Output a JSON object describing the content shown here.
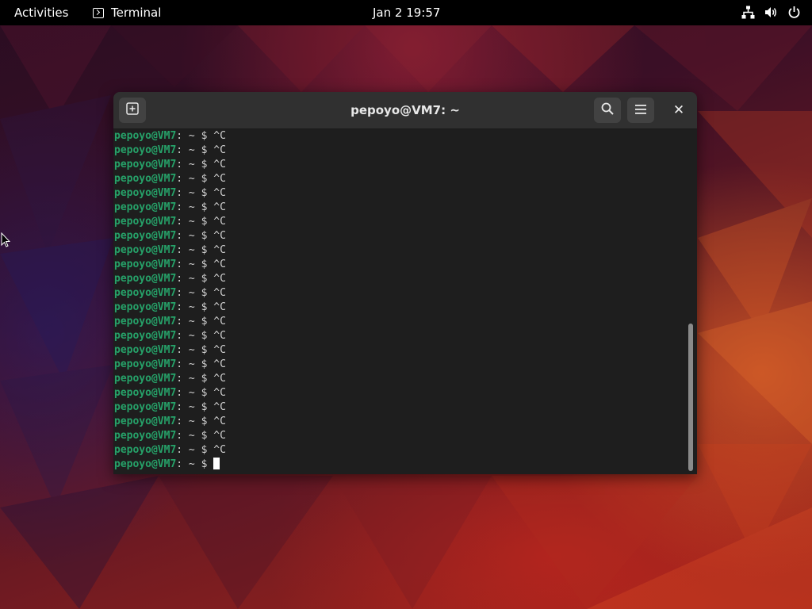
{
  "topbar": {
    "activities_label": "Activities",
    "app_name": "Terminal",
    "clock": "Jan 2  19:57",
    "tray_icons": [
      "network-icon",
      "volume-icon",
      "power-icon"
    ]
  },
  "window": {
    "title": "pepoyo@VM7: ~",
    "buttons": [
      "new-tab-icon",
      "search-icon",
      "hamburger-menu-icon",
      "close-icon"
    ],
    "close_glyph": "✕"
  },
  "terminal": {
    "prompt_user": "pepoyo@VM7",
    "prompt_sep": ":",
    "prompt_path": " ~",
    "prompt_symbol": " $ ",
    "lines": [
      "^C",
      "^C",
      "^C",
      "^C",
      "^C",
      "^C",
      "^C",
      "^C",
      "^C",
      "^C",
      "^C",
      "^C",
      "^C",
      "^C",
      "^C",
      "^C",
      "^C",
      "^C",
      "^C",
      "^C",
      "^C",
      "^C",
      "^C",
      ""
    ],
    "colors": {
      "prompt": "#26a269",
      "text": "#d0d0d0",
      "background": "#1e1e1e"
    }
  }
}
